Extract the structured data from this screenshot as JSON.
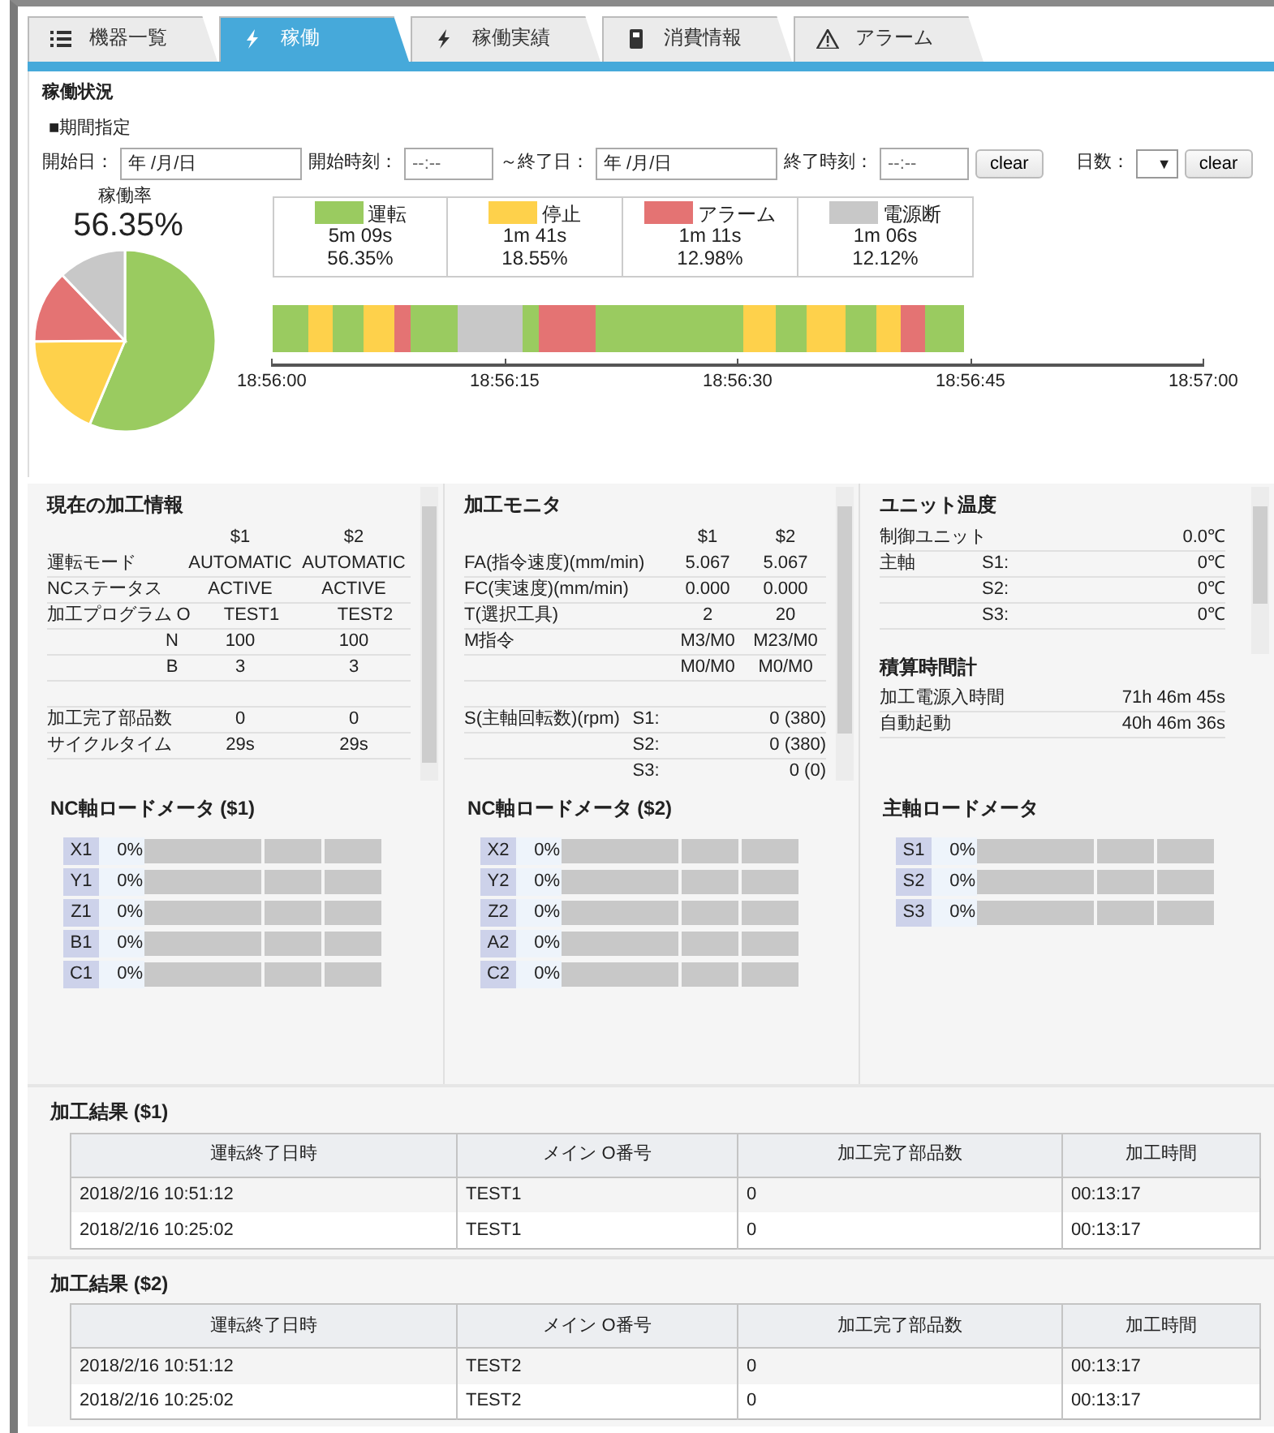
{
  "tabs": [
    {
      "label": "機器一覧",
      "selected": false
    },
    {
      "label": "稼働",
      "selected": true
    },
    {
      "label": "稼働実績",
      "selected": false
    },
    {
      "label": "消費情報",
      "selected": false
    },
    {
      "label": "アラーム",
      "selected": false
    }
  ],
  "status": {
    "title": "稼働状況",
    "period_label": "■期間指定",
    "filters": [
      {
        "kind": "input",
        "label": "開始日：",
        "value": "年 /月/日"
      },
      {
        "kind": "input",
        "label": "開始時刻：",
        "value": "--:--"
      },
      {
        "kind": "input",
        "label": "～終了日：",
        "value": "年 /月/日"
      },
      {
        "kind": "input",
        "label": "終了時刻：",
        "value": "--:--"
      },
      {
        "kind": "button",
        "label": "clear"
      },
      {
        "kind": "select",
        "label": "日数：",
        "value": "▼"
      },
      {
        "kind": "button",
        "label": "clear"
      }
    ],
    "rate_label": "稼働率",
    "rate_value": "56.35%",
    "pie": {
      "chart_data": {
        "type": "pie",
        "values": [
          56.35,
          18.55,
          12.98,
          12.12
        ]
      }
    },
    "legend": [
      {
        "label": "運転",
        "color": "#9acb60",
        "time": "5m 09s",
        "percent": "56.35%"
      },
      {
        "label": "停止",
        "color": "#fed14b",
        "time": "1m 41s",
        "percent": "18.55%"
      },
      {
        "label": "アラーム",
        "color": "#e47373",
        "time": "1m 11s",
        "percent": "12.98%"
      },
      {
        "label": "電源断",
        "color": "#c8c8c8",
        "time": "1m 06s",
        "percent": "12.12%"
      }
    ],
    "timeline": {
      "segments": [
        {
          "kind": "run"
        },
        {
          "kind": "stop"
        },
        {
          "kind": "run"
        },
        {
          "kind": "stop"
        },
        {
          "kind": "alarm"
        },
        {
          "kind": "run"
        },
        {
          "kind": "off"
        },
        {
          "kind": "run"
        },
        {
          "kind": "alarm"
        },
        {
          "kind": "run"
        },
        {
          "kind": "stop"
        },
        {
          "kind": "run"
        },
        {
          "kind": "stop"
        },
        {
          "kind": "run"
        },
        {
          "kind": "stop"
        },
        {
          "kind": "alarm"
        },
        {
          "kind": "run"
        }
      ],
      "ticks": [
        "18:56:00",
        "18:56:15",
        "18:56:30",
        "18:56:45",
        "18:57:00"
      ]
    }
  },
  "current_info": {
    "title": "現在の加工情報",
    "columns": [
      "$1",
      "$2"
    ],
    "rows": [
      {
        "kind": "data",
        "label": "運転モード",
        "values": [
          "AUTOMATIC",
          "AUTOMATIC"
        ]
      },
      {
        "kind": "data",
        "label": "NCステータス",
        "values": [
          "ACTIVE",
          "ACTIVE"
        ]
      },
      {
        "kind": "data",
        "label": "加工プログラム",
        "sub": "O",
        "values": [
          "TEST1",
          "TEST2"
        ]
      },
      {
        "kind": "data",
        "sub": "N",
        "values": [
          "100",
          "100"
        ]
      },
      {
        "kind": "data",
        "sub": "B",
        "values": [
          "3",
          "3"
        ]
      },
      {
        "kind": "blank"
      },
      {
        "kind": "data",
        "label": "加工完了部品数",
        "values": [
          "0",
          "0"
        ]
      },
      {
        "kind": "data",
        "label": "サイクルタイム",
        "values": [
          "29s",
          "29s"
        ]
      }
    ]
  },
  "monitor": {
    "title": "加工モニタ",
    "columns": [
      "$1",
      "$2"
    ],
    "rows": [
      {
        "kind": "data",
        "label": "FA(指令速度)(mm/min)",
        "values": [
          "5.067",
          "5.067"
        ]
      },
      {
        "kind": "data",
        "label": "FC(実速度)(mm/min)",
        "values": [
          "0.000",
          "0.000"
        ]
      },
      {
        "kind": "data",
        "label": "T(選択工具)",
        "values": [
          "2",
          "20"
        ]
      },
      {
        "kind": "data",
        "label": "M指令",
        "values": [
          "M3/M0",
          "M23/M0"
        ]
      },
      {
        "kind": "data",
        "values": [
          "M0/M0",
          "M0/M0"
        ]
      },
      {
        "kind": "blank"
      },
      {
        "kind": "data",
        "label": "S(主軸回転数)(rpm)",
        "sub": "S1:",
        "values": [
          "0 (380)"
        ]
      },
      {
        "kind": "data",
        "sub": "S2:",
        "values": [
          "0 (380)"
        ]
      },
      {
        "kind": "data",
        "sub": "S3:",
        "values": [
          "0 (0)"
        ]
      }
    ]
  },
  "unit_temp": {
    "title": "ユニット温度",
    "rows": [
      {
        "kind": "data",
        "label": "制御ユニット",
        "values": [
          "0.0℃"
        ]
      },
      {
        "kind": "data",
        "label": "主軸",
        "sub": "S1:",
        "values": [
          "0℃"
        ]
      },
      {
        "kind": "data",
        "sub": "S2:",
        "values": [
          "0℃"
        ]
      },
      {
        "kind": "data",
        "sub": "S3:",
        "values": [
          "0℃"
        ]
      }
    ]
  },
  "hour_meter": {
    "title": "積算時間計",
    "rows": [
      {
        "kind": "data",
        "label": "加工電源入時間",
        "values": [
          "71h 46m 45s"
        ]
      },
      {
        "kind": "data",
        "label": "自動起動",
        "values": [
          "40h 46m 36s"
        ]
      }
    ]
  },
  "load_meters": [
    {
      "title": "NC軸ロードメータ ($1)",
      "axes": [
        {
          "axis": "X1",
          "reading": "0%"
        },
        {
          "axis": "Y1",
          "reading": "0%"
        },
        {
          "axis": "Z1",
          "reading": "0%"
        },
        {
          "axis": "B1",
          "reading": "0%"
        },
        {
          "axis": "C1",
          "reading": "0%"
        }
      ]
    },
    {
      "title": "NC軸ロードメータ ($2)",
      "axes": [
        {
          "axis": "X2",
          "reading": "0%"
        },
        {
          "axis": "Y2",
          "reading": "0%"
        },
        {
          "axis": "Z2",
          "reading": "0%"
        },
        {
          "axis": "A2",
          "reading": "0%"
        },
        {
          "axis": "C2",
          "reading": "0%"
        }
      ]
    },
    {
      "title": "主軸ロードメータ",
      "axes": [
        {
          "axis": "S1",
          "reading": "0%"
        },
        {
          "axis": "S2",
          "reading": "0%"
        },
        {
          "axis": "S3",
          "reading": "0%"
        }
      ]
    }
  ],
  "results": [
    {
      "title": "加工結果 ($1)",
      "columns": [
        "運転終了日時",
        "メイン O番号",
        "加工完了部品数",
        "加工時間"
      ],
      "rows": [
        [
          "2018/2/16 10:51:12",
          "TEST1",
          "0",
          "00:13:17"
        ],
        [
          "2018/2/16 10:25:02",
          "TEST1",
          "0",
          "00:13:17"
        ]
      ]
    },
    {
      "title": "加工結果 ($2)",
      "columns": [
        "運転終了日時",
        "メイン O番号",
        "加工完了部品数",
        "加工時間"
      ],
      "rows": [
        [
          "2018/2/16 10:51:12",
          "TEST2",
          "0",
          "00:13:17"
        ],
        [
          "2018/2/16 10:25:02",
          "TEST2",
          "0",
          "00:13:17"
        ]
      ]
    }
  ]
}
